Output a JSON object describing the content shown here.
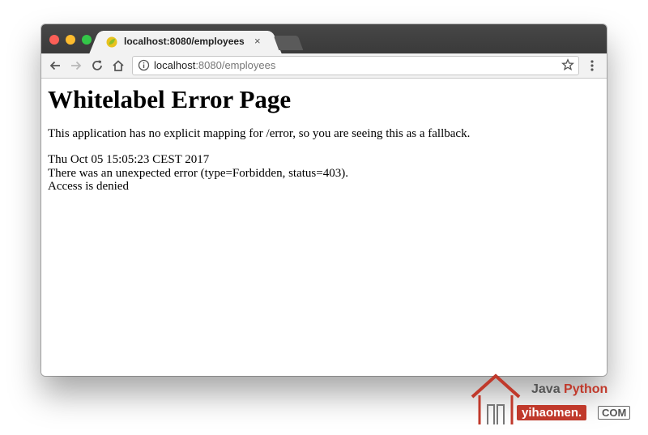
{
  "browser": {
    "tab": {
      "title": "localhost:8080/employees",
      "close_glyph": "×",
      "favicon": "spring-leaf-icon"
    },
    "address_bar": {
      "host": "localhost",
      "rest": ":8080/employees"
    },
    "icons": [
      "back-arrow-icon",
      "forward-arrow-icon",
      "reload-icon",
      "home-icon",
      "info-icon",
      "star-icon",
      "menu-icon"
    ]
  },
  "page": {
    "heading": "Whitelabel Error Page",
    "lead": "This application has no explicit mapping for /error, so you are seeing this as a fallback.",
    "timestamp": "Thu Oct 05 15:05:23 CEST 2017",
    "error": "There was an unexpected error (type=Forbidden, status=403).",
    "message": "Access is denied"
  },
  "watermark": {
    "java": "Java",
    "python": "Python",
    "domain": "yihaomen.",
    "tld": "COM"
  },
  "colors": {
    "accent_red": "#c0392b",
    "titlebar": "#3f3f3f",
    "toolbar": "#f2f2f2"
  }
}
